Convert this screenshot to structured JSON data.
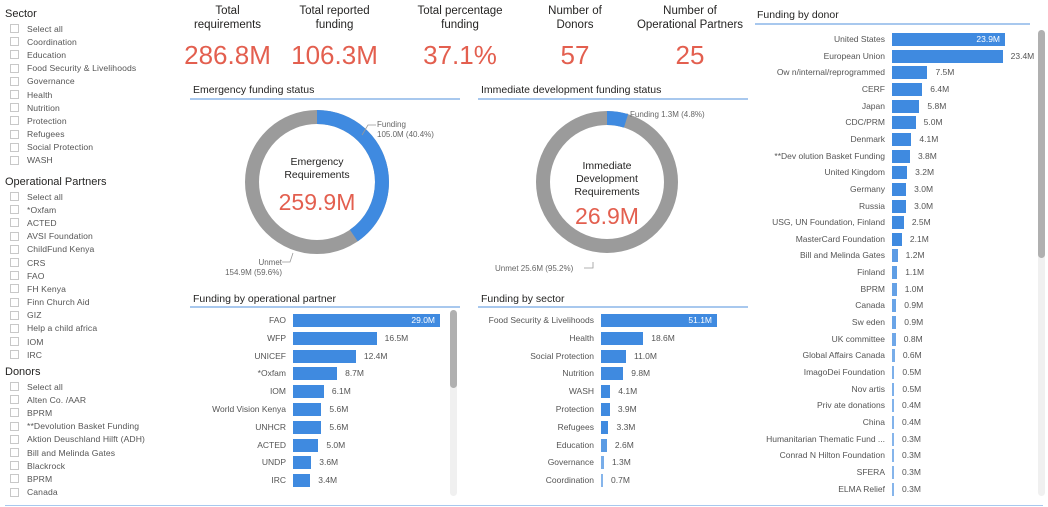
{
  "slicers": {
    "sector": {
      "title": "Sector",
      "items": [
        "Select all",
        "Coordination",
        "Education",
        "Food Security & Livelihoods",
        "Governance",
        "Health",
        "Nutrition",
        "Protection",
        "Refugees",
        "Social Protection",
        "WASH"
      ]
    },
    "partners": {
      "title": "Operational Partners",
      "items": [
        "Select all",
        "*Oxfam",
        "ACTED",
        "AVSI Foundation",
        "ChildFund Kenya",
        "CRS",
        "FAO",
        "FH Kenya",
        "Finn Church Aid",
        "GIZ",
        "Help a child africa",
        "IOM",
        "IRC"
      ]
    },
    "donors": {
      "title": "Donors",
      "items": [
        "Select all",
        " Alten Co. /AAR",
        " BPRM",
        "**Devolution Basket Funding",
        "Aktion Deuschland Hilft (ADH)",
        "Bill and Melinda Gates",
        "Blackrock",
        "BPRM",
        "Canada"
      ]
    }
  },
  "kpis": [
    {
      "label_line1": "Total",
      "label_line2": "requirements",
      "value": "286.8M"
    },
    {
      "label_line1": "Total reported",
      "label_line2": "funding",
      "value": "106.3M"
    },
    {
      "label_line1": "Total percentage",
      "label_line2": "funding",
      "value": "37.1%"
    },
    {
      "label_line1": "Number of",
      "label_line2": "Donors",
      "value": "57"
    },
    {
      "label_line1": "Number of",
      "label_line2": "Operational Partners",
      "value": "25"
    }
  ],
  "colors": {
    "funded": "#3f8ae0",
    "unmet": "#9b9b9b",
    "accent_value": "#e35f4f",
    "rule": "#a8c8ee"
  },
  "emergency": {
    "title": "Emergency funding status",
    "center_line1": "Emergency",
    "center_line2": "Requirements",
    "total": "259.9M",
    "funded_pct": 40.4,
    "funded_label_1": "Funding",
    "funded_label_2": "105.0M (40.4%)",
    "unmet_label_1": "Unmet",
    "unmet_label_2": "154.9M (59.6%)"
  },
  "development": {
    "title": "Immediate development funding status",
    "center_line1": "Immediate",
    "center_line2": "Development",
    "center_line3": "Requirements",
    "total": "26.9M",
    "funded_pct": 4.8,
    "funded_label": "Funding 1.3M (4.8%)",
    "unmet_label": "Unmet 25.6M (95.2%)"
  },
  "chart_data": [
    {
      "type": "bar",
      "orientation": "horizontal",
      "title": "Funding by operational partner",
      "categories": [
        "FAO",
        "WFP",
        "UNICEF",
        "*Oxfam",
        "IOM",
        "World Vision Kenya",
        "UNHCR",
        "ACTED",
        "UNDP",
        "IRC"
      ],
      "values": [
        29.0,
        16.5,
        12.4,
        8.7,
        6.1,
        5.6,
        5.6,
        5.0,
        3.6,
        3.4
      ],
      "labels": [
        "29.0M",
        "16.5M",
        "12.4M",
        "8.7M",
        "6.1M",
        "5.6M",
        "5.6M",
        "5.0M",
        "3.6M",
        "3.4M"
      ],
      "unit": "M",
      "scroll": {
        "thumb_start": 0.0,
        "thumb_end": 0.42
      }
    },
    {
      "type": "bar",
      "orientation": "horizontal",
      "title": "Funding by sector",
      "categories": [
        "Food Security & Livelihoods",
        "Health",
        "Social Protection",
        "Nutrition",
        "WASH",
        "Protection",
        "Refugees",
        "Education",
        "Governance",
        "Coordination"
      ],
      "values": [
        51.1,
        18.6,
        11.0,
        9.8,
        4.1,
        3.9,
        3.3,
        2.6,
        1.3,
        0.7
      ],
      "labels": [
        "51.1M",
        "18.6M",
        "11.0M",
        "9.8M",
        "4.1M",
        "3.9M",
        "3.3M",
        "2.6M",
        "1.3M",
        "0.7M"
      ],
      "unit": "M"
    },
    {
      "type": "bar",
      "orientation": "horizontal",
      "title": "Funding by donor",
      "categories": [
        "United States",
        "European Union",
        "Ow n/internal/reprogrammed",
        "CERF",
        "Japan",
        "CDC/PRM",
        "Denmark",
        "**Dev olution Basket Funding",
        "United Kingdom",
        "Germany",
        "Russia",
        "USG, UN Foundation, Finland",
        "MasterCard Foundation",
        "Bill and Melinda Gates",
        "Finland",
        "BPRM",
        "Canada",
        "Sw eden",
        "UK committee",
        "Global Affairs Canada",
        "ImagoDei Foundation",
        "Nov artis",
        "Priv ate donations",
        "China",
        "Humanitarian Thematic Fund ...",
        "Conrad N Hilton Foundation",
        "SFERA",
        "ELMA Relief"
      ],
      "values": [
        23.9,
        23.4,
        7.5,
        6.4,
        5.8,
        5.0,
        4.1,
        3.8,
        3.2,
        3.0,
        3.0,
        2.5,
        2.1,
        1.2,
        1.1,
        1.0,
        0.9,
        0.9,
        0.8,
        0.6,
        0.5,
        0.5,
        0.4,
        0.4,
        0.3,
        0.3,
        0.3,
        0.3
      ],
      "labels": [
        "23.9M",
        "23.4M",
        "7.5M",
        "6.4M",
        "5.8M",
        "5.0M",
        "4.1M",
        "3.8M",
        "3.2M",
        "3.0M",
        "3.0M",
        "2.5M",
        "2.1M",
        "1.2M",
        "1.1M",
        "1.0M",
        "0.9M",
        "0.9M",
        "0.8M",
        "0.6M",
        "0.5M",
        "0.5M",
        "0.4M",
        "0.4M",
        "0.3M",
        "0.3M",
        "0.3M",
        "0.3M"
      ],
      "unit": "M",
      "scroll": {
        "thumb_start": 0.0,
        "thumb_end": 0.49
      }
    }
  ]
}
